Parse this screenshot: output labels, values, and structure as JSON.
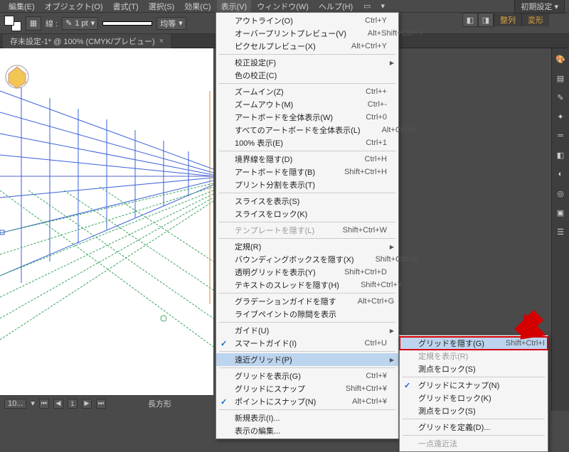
{
  "menubar": {
    "items": [
      "編集(E)",
      "オブジェクト(O)",
      "書式(T)",
      "選択(S)",
      "効果(C)",
      "表示(V)",
      "ウィンドウ(W)",
      "ヘルプ(H)"
    ],
    "active_index": 5,
    "workspace_label": "初期設定"
  },
  "toolbar": {
    "stroke_label": "線 :",
    "stroke_pt": "1 pt",
    "uniform_label": "均等"
  },
  "tabbar": {
    "tab_title": "存未設定-1* @ 100% (CMYK/プレビュー)"
  },
  "panels": {
    "arrange": "整列",
    "transform": "変形"
  },
  "statusbar": {
    "zoom": "10...",
    "shape": "長方形"
  },
  "menu_main": {
    "groups": [
      [
        {
          "label": "アウトライン(O)",
          "sc": "Ctrl+Y"
        },
        {
          "label": "オーバープリントプレビュー(V)",
          "sc": "Alt+Shift+Ctrl+Y"
        },
        {
          "label": "ピクセルプレビュー(X)",
          "sc": "Alt+Ctrl+Y"
        }
      ],
      [
        {
          "label": "校正設定(F)",
          "sub": true
        },
        {
          "label": "色の校正(C)"
        }
      ],
      [
        {
          "label": "ズームイン(Z)",
          "sc": "Ctrl++"
        },
        {
          "label": "ズームアウト(M)",
          "sc": "Ctrl+-"
        },
        {
          "label": "アートボードを全体表示(W)",
          "sc": "Ctrl+0"
        },
        {
          "label": "すべてのアートボードを全体表示(L)",
          "sc": "Alt+Ctrl+0"
        },
        {
          "label": "100% 表示(E)",
          "sc": "Ctrl+1"
        }
      ],
      [
        {
          "label": "境界線を隠す(D)",
          "sc": "Ctrl+H"
        },
        {
          "label": "アートボードを隠す(B)",
          "sc": "Shift+Ctrl+H"
        },
        {
          "label": "プリント分割を表示(T)"
        }
      ],
      [
        {
          "label": "スライスを表示(S)"
        },
        {
          "label": "スライスをロック(K)"
        }
      ],
      [
        {
          "label": "テンプレートを隠す(L)",
          "sc": "Shift+Ctrl+W",
          "disabled": true
        }
      ],
      [
        {
          "label": "定規(R)",
          "sub": true
        },
        {
          "label": "バウンディングボックスを隠す(X)",
          "sc": "Shift+Ctrl+B"
        },
        {
          "label": "透明グリッドを表示(Y)",
          "sc": "Shift+Ctrl+D"
        },
        {
          "label": "テキストのスレッドを隠す(H)",
          "sc": "Shift+Ctrl+Y"
        }
      ],
      [
        {
          "label": "グラデーションガイドを隠す",
          "sc": "Alt+Ctrl+G"
        },
        {
          "label": "ライブペイントの隙間を表示"
        }
      ],
      [
        {
          "label": "ガイド(U)",
          "sub": true
        },
        {
          "label": "スマートガイド(I)",
          "sc": "Ctrl+U",
          "checked": true
        }
      ],
      [
        {
          "label": "遠近グリッド(P)",
          "sub": true,
          "hover": true
        }
      ],
      [
        {
          "label": "グリッドを表示(G)",
          "sc": "Ctrl+¥"
        },
        {
          "label": "グリッドにスナップ",
          "sc": "Shift+Ctrl+¥"
        },
        {
          "label": "ポイントにスナップ(N)",
          "sc": "Alt+Ctrl+¥",
          "checked": true
        }
      ],
      [
        {
          "label": "新規表示(I)..."
        },
        {
          "label": "表示の編集..."
        }
      ]
    ]
  },
  "menu_sub": {
    "groups": [
      [
        {
          "label": "グリッドを隠す(G)",
          "sc": "Shift+Ctrl+I",
          "hi": true
        },
        {
          "label": "定規を表示(R)",
          "disabled": true
        },
        {
          "label": "測点をロック(S)"
        }
      ],
      [
        {
          "label": "グリッドにスナップ(N)",
          "checked": true
        },
        {
          "label": "グリッドをロック(K)"
        },
        {
          "label": "測点をロック(S)"
        }
      ],
      [
        {
          "label": "グリッドを定義(D)..."
        }
      ],
      [
        {
          "label": "一点遠近法",
          "disabled": true
        }
      ]
    ]
  },
  "dock_icons": [
    "palette-icon",
    "swatches-icon",
    "brush-icon",
    "symbol-icon",
    "stroke-icon",
    "gradient-icon",
    "transparency-icon",
    "appearance-icon",
    "graphic-styles-icon",
    "layers-icon"
  ]
}
